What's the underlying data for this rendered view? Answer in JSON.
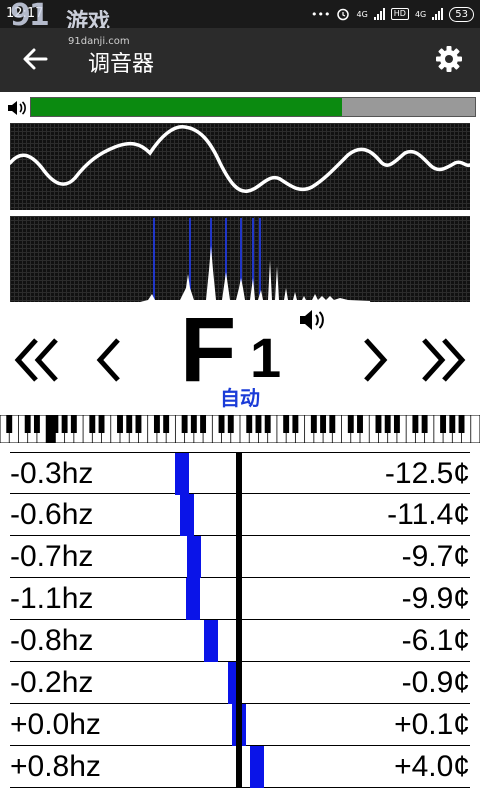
{
  "status_bar": {
    "time": "12:17",
    "watermark_number": "91",
    "watermark_text": "游戏",
    "watermark_site": "91danji.com",
    "network1": "4G",
    "hd_badge": "HD",
    "network2": "4G",
    "battery": "53"
  },
  "app_bar": {
    "title": "调音器",
    "back_icon": "arrow-left",
    "settings_icon": "gear"
  },
  "volume": {
    "level": 0.7,
    "fill_color": "#0b8a10",
    "track_color": "#999999"
  },
  "tuner": {
    "note_letter": "F",
    "note_octave": "1",
    "mode_label": "自动",
    "mode_color": "#1a3bd8",
    "prev_octave_icon": "double-chevron-left",
    "prev_note_icon": "chevron-left",
    "next_note_icon": "chevron-right",
    "next_octave_icon": "double-chevron-right",
    "sound_icon": "speaker"
  },
  "readings": [
    {
      "hz": "-0.3hz",
      "cents": "-12.5¢",
      "offset": -12.5
    },
    {
      "hz": "-0.6hz",
      "cents": "-11.4¢",
      "offset": -11.4
    },
    {
      "hz": "-0.7hz",
      "cents": "-9.7¢",
      "offset": -9.7
    },
    {
      "hz": "-1.1hz",
      "cents": "-9.9¢",
      "offset": -9.9
    },
    {
      "hz": "-0.8hz",
      "cents": "-6.1¢",
      "offset": -6.1
    },
    {
      "hz": "-0.2hz",
      "cents": "-0.9¢",
      "offset": -0.9
    },
    {
      "hz": "+0.0hz",
      "cents": "+0.1¢",
      "offset": 0.1
    },
    {
      "hz": "+0.8hz",
      "cents": "+4.0¢",
      "offset": 4.0
    }
  ],
  "colors": {
    "bar": "#0a14e8",
    "wave_line": "#ffffff",
    "spectrum_peak": "#ffffff",
    "spectrum_marker": "#2036c8"
  }
}
